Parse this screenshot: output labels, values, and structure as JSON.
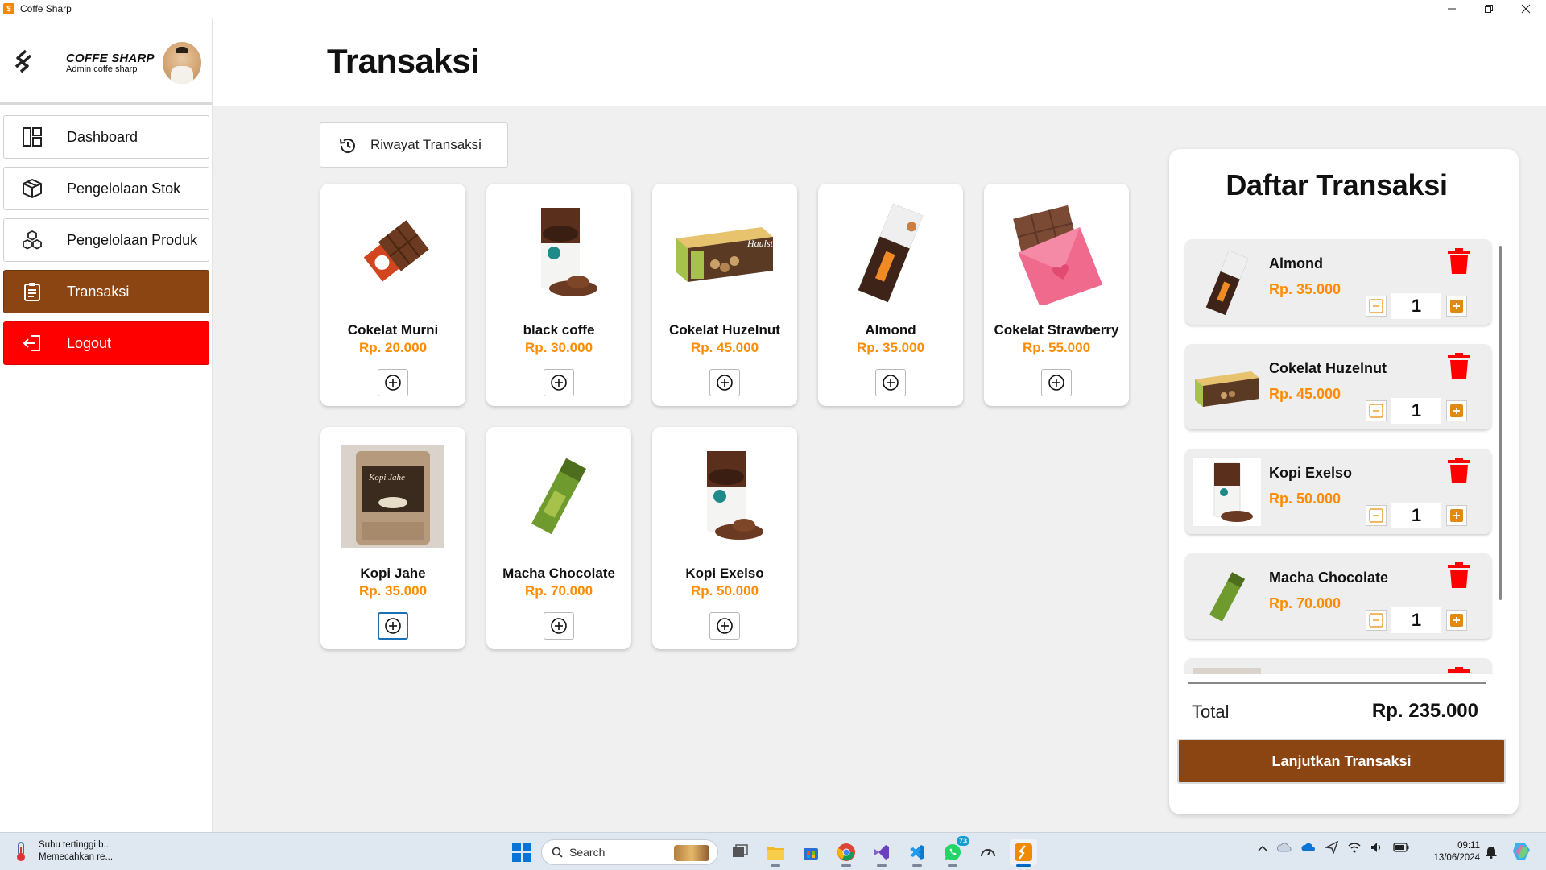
{
  "window": {
    "title": "Coffe Sharp",
    "app_icon": "coffee-sharp-logo-icon"
  },
  "sidebar": {
    "brand_name": "COFFE SHARP",
    "brand_sub": "Admin coffe sharp",
    "items": [
      {
        "label": "Dashboard",
        "icon": "dashboard-icon"
      },
      {
        "label": "Pengelolaan Stok",
        "icon": "box-icon"
      },
      {
        "label": "Pengelolaan Produk",
        "icon": "boxes-icon"
      },
      {
        "label": "Transaksi",
        "icon": "clipboard-icon",
        "active": true
      },
      {
        "label": "Logout",
        "icon": "logout-icon"
      }
    ]
  },
  "header": {
    "title": "Transaksi"
  },
  "history_button": {
    "label": "Riwayat Transaksi",
    "icon": "history-icon"
  },
  "products": [
    {
      "name": "Cokelat Murni",
      "price": "Rp. 20.000"
    },
    {
      "name": "black coffe",
      "price": "Rp. 30.000"
    },
    {
      "name": "Cokelat Huzelnut",
      "price": "Rp. 45.000"
    },
    {
      "name": "Almond",
      "price": "Rp. 35.000"
    },
    {
      "name": "Cokelat Strawberry",
      "price": "Rp. 55.000"
    },
    {
      "name": "Kopi Jahe",
      "price": "Rp. 35.000"
    },
    {
      "name": "Macha Chocolate",
      "price": "Rp. 70.000"
    },
    {
      "name": "Kopi Exelso",
      "price": "Rp. 50.000"
    }
  ],
  "cart": {
    "title": "Daftar Transaksi",
    "items": [
      {
        "name": "Almond",
        "price": "Rp. 35.000",
        "qty": "1"
      },
      {
        "name": "Cokelat Huzelnut",
        "price": "Rp. 45.000",
        "qty": "1"
      },
      {
        "name": "Kopi Exelso",
        "price": "Rp. 50.000",
        "qty": "1"
      },
      {
        "name": "Macha Chocolate",
        "price": "Rp. 70.000",
        "qty": "1"
      }
    ],
    "total_label": "Total",
    "total_value": "Rp. 235.000",
    "checkout_label": "Lanjutkan Transaksi"
  },
  "taskbar": {
    "weather_line1": "Suhu tertinggi b...",
    "weather_line2": "Memecahkan re...",
    "search_label": "Search",
    "whatsapp_badge": "73",
    "time": "09:11",
    "date": "13/06/2024"
  },
  "colors": {
    "accent_brown": "#8b4513",
    "logout_red": "#ff0000",
    "price_orange": "#ff8c00",
    "delete_red": "#ff0000"
  }
}
